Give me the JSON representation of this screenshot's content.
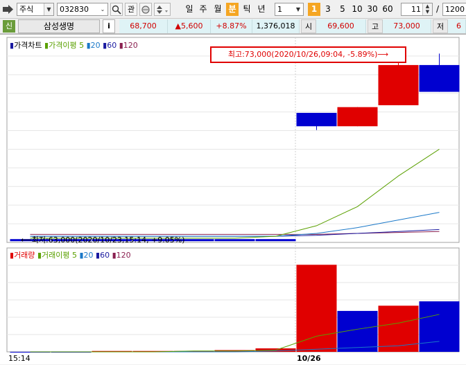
{
  "toolbar": {
    "market_type": "주식",
    "stock_code": "032830",
    "search_icon": "search-icon",
    "watch_label": "관",
    "period_buttons": [
      "일",
      "주",
      "월",
      "분",
      "틱",
      "년"
    ],
    "active_period": "분",
    "period_value": "1",
    "minute_options": [
      "1",
      "3",
      "5",
      "10",
      "30",
      "60"
    ],
    "active_minute": "1",
    "count_value": "11",
    "slash": "/",
    "total_value": "1200"
  },
  "infobar": {
    "badge": "신",
    "stock_name": "삼성생명",
    "info_button": "i",
    "price": "68,700",
    "change": "▲5,600",
    "change_pct": "+8.87%",
    "volume": "1,376,018",
    "open_label": "시",
    "open_value": "69,600",
    "high_label": "고",
    "high_value": "73,000",
    "low_label": "저",
    "low_value": "6"
  },
  "price_legend": {
    "price_chart": "가격차트",
    "ma_label": "가격이평",
    "ma5": "5",
    "ma20": "20",
    "ma60": "60",
    "ma120": "120"
  },
  "volume_legend": {
    "volume": "거래량",
    "ma_label": "거래이평",
    "ma5": "5",
    "ma20": "20",
    "ma60": "60",
    "ma120": "120"
  },
  "annotations": {
    "high": "최고:73,000(2020/10/26,09:04, -5.89%)⟶",
    "low": "⟵최저:63,000(2020/10/23,15:14, +9.05%)"
  },
  "x_labels": {
    "left": "15:14",
    "mid": "10/26"
  },
  "colors": {
    "up": "#e00000",
    "down": "#0000d0",
    "ma5": "#5aa000",
    "ma20": "#1a78c8",
    "ma60": "#1a1aa0",
    "ma120": "#8a2050",
    "accent": "#f5a623",
    "info_bg": "#dff3f6"
  },
  "chart_data": [
    {
      "type": "candlestick",
      "title": "가격차트",
      "candles": [
        {
          "open": 63000,
          "high": 63000,
          "low": 63000,
          "close": 63000,
          "dir": "down"
        },
        {
          "open": 63000,
          "high": 63000,
          "low": 63000,
          "close": 63000,
          "dir": "down"
        },
        {
          "open": 63000,
          "high": 63000,
          "low": 63000,
          "close": 63000,
          "dir": "down"
        },
        {
          "open": 63000,
          "high": 63000,
          "low": 63000,
          "close": 63000,
          "dir": "down"
        },
        {
          "open": 63000,
          "high": 63000,
          "low": 63000,
          "close": 63000,
          "dir": "down"
        },
        {
          "open": 63000,
          "high": 63000,
          "low": 63000,
          "close": 63000,
          "dir": "down"
        },
        {
          "open": 63000,
          "high": 63000,
          "low": 63000,
          "close": 63000,
          "dir": "down"
        },
        {
          "open": 69600,
          "high": 69600,
          "low": 68700,
          "close": 68900,
          "dir": "down"
        },
        {
          "open": 68900,
          "high": 69900,
          "low": 68900,
          "close": 69900,
          "dir": "up"
        },
        {
          "open": 70000,
          "high": 73000,
          "low": 70000,
          "close": 72100,
          "dir": "up"
        },
        {
          "open": 72100,
          "high": 72700,
          "low": 70700,
          "close": 70700,
          "dir": "down"
        }
      ],
      "ma5": [
        63050,
        63050,
        63050,
        63050,
        63050,
        63050,
        63150,
        63700,
        64700,
        66300,
        67700
      ],
      "ma20": [
        63150,
        63150,
        63150,
        63150,
        63150,
        63150,
        63150,
        63300,
        63600,
        64000,
        64400
      ],
      "ma60": [
        63150,
        63150,
        63150,
        63150,
        63150,
        63150,
        63150,
        63200,
        63300,
        63400,
        63500
      ],
      "ma120": [
        63250,
        63250,
        63250,
        63250,
        63250,
        63250,
        63250,
        63250,
        63300,
        63350,
        63400
      ],
      "ylim": [
        62900,
        73400
      ]
    },
    {
      "type": "bar",
      "title": "거래량",
      "values": [
        0,
        0,
        1,
        1,
        1,
        2,
        4,
        100,
        47,
        53,
        58
      ],
      "dirs": [
        "down",
        "down",
        "up",
        "up",
        "up",
        "up",
        "up",
        "up",
        "down",
        "up",
        "down"
      ],
      "ma5": [
        0,
        0,
        0,
        0,
        1,
        1,
        2,
        18,
        26,
        33,
        43
      ],
      "ma20": [
        0,
        0,
        0,
        0,
        0,
        0,
        1,
        3,
        5,
        7,
        12
      ],
      "ylim": [
        0,
        105
      ]
    }
  ]
}
